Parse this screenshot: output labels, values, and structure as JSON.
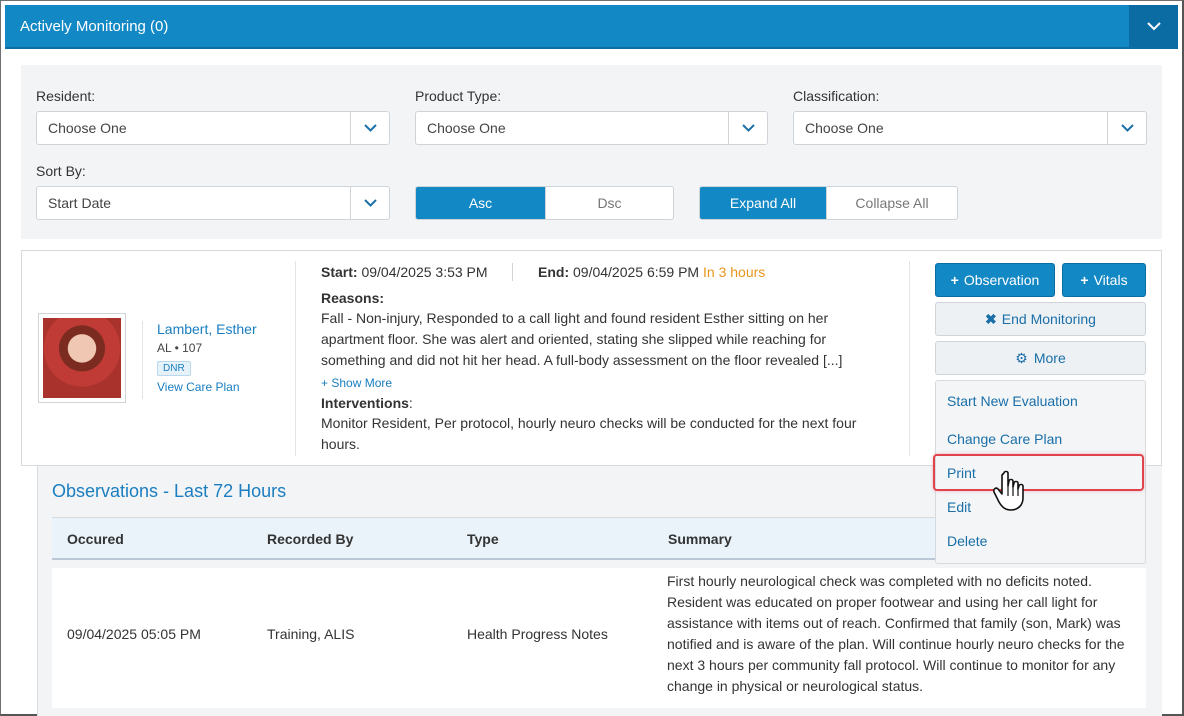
{
  "header": {
    "title": "Actively Monitoring (0)"
  },
  "filters": {
    "resident": {
      "label": "Resident:",
      "value": "Choose One"
    },
    "product_type": {
      "label": "Product Type:",
      "value": "Choose One"
    },
    "classification": {
      "label": "Classification:",
      "value": "Choose One"
    },
    "sort_by": {
      "label": "Sort By:",
      "value": "Start Date"
    },
    "order": {
      "asc": "Asc",
      "dsc": "Dsc",
      "selected": "Asc"
    },
    "expand": {
      "expand_all": "Expand All",
      "collapse_all": "Collapse All",
      "selected": "Expand All"
    }
  },
  "resident": {
    "name": "Lambert, Esther",
    "level": "AL",
    "room": "107",
    "badge": "DNR",
    "care_plan_link": "View Care Plan"
  },
  "monitoring": {
    "start_label": "Start:",
    "start_value": "09/04/2025 3:53 PM",
    "end_label": "End:",
    "end_value": "09/04/2025 6:59 PM",
    "end_relative": "In 3 hours",
    "reasons_label": "Reasons:",
    "reasons_text": "Fall - Non-injury, Responded to a call light and found resident Esther sitting on her apartment floor. She was alert and oriented, stating she slipped while reaching for something and did not hit her head. A full-body assessment on the floor revealed [...]",
    "show_more": "Show More",
    "interventions_label": "Interventions",
    "interventions_text": "Monitor Resident, Per protocol, hourly neuro checks will be conducted for the next four hours."
  },
  "actions": {
    "observation": "Observation",
    "vitals": "Vitals",
    "end_monitoring": "End Monitoring",
    "more": "More",
    "menu": [
      "Start New Evaluation",
      "Change Care Plan",
      "Print",
      "Edit",
      "Delete"
    ],
    "highlighted_item": "Print"
  },
  "observations": {
    "title": "Observations - Last 72 Hours",
    "columns": [
      "Occured",
      "Recorded By",
      "Type",
      "Summary"
    ],
    "rows": [
      {
        "occured": "09/04/2025 05:05 PM",
        "recorded_by": "Training, ALIS",
        "type": "Health Progress Notes",
        "summary": "First hourly neurological check was completed with no deficits noted. Resident was educated on proper footwear and using her call light for assistance with items out of reach. Confirmed that family (son, Mark) was notified and is aware of the plan. Will continue hourly neuro checks for the next 3 hours per community fall protocol. Will continue to monitor for any change in physical or neurological status."
      }
    ]
  },
  "colors": {
    "primary": "#1288c4",
    "link": "#1a7ec0",
    "warning": "#e8961b",
    "highlight": "#e0434b"
  },
  "icons": [
    "chevron-down-icon",
    "plus-icon",
    "close-icon",
    "gear-icon",
    "hand-pointer-icon"
  ]
}
